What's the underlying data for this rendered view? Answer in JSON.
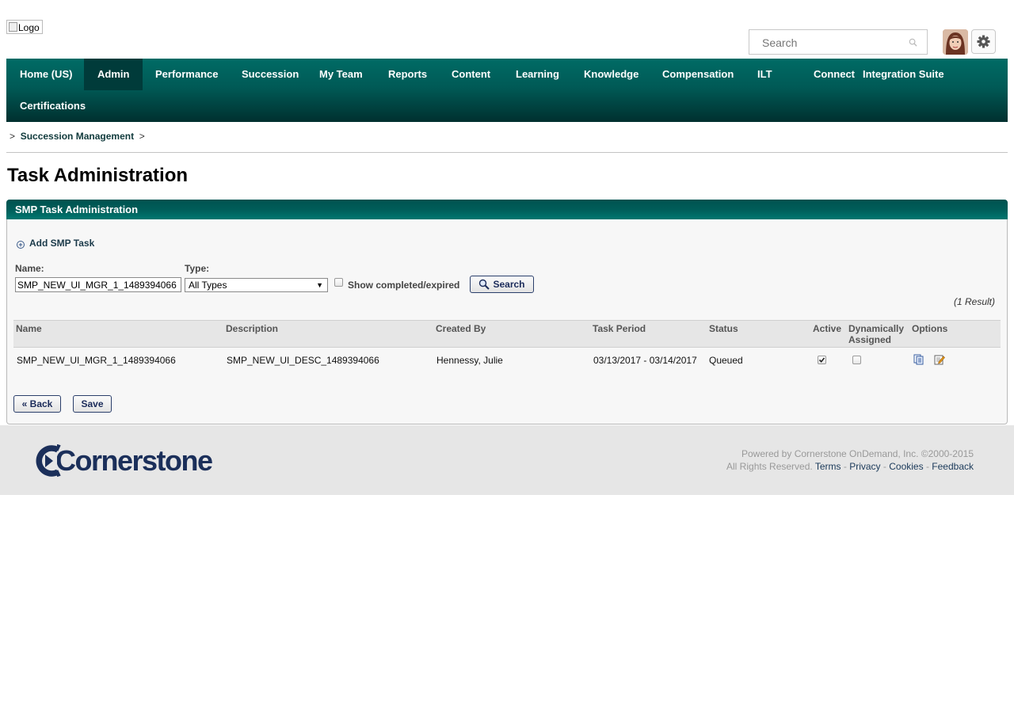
{
  "header": {
    "logo_alt": "Logo",
    "search": {
      "placeholder": "Search"
    }
  },
  "nav": {
    "items": [
      {
        "label": "Home (US)"
      },
      {
        "label": "Admin",
        "active": true
      },
      {
        "label": "Performance"
      },
      {
        "label": "Succession"
      },
      {
        "label": "My Team"
      },
      {
        "label": "Reports"
      },
      {
        "label": "Content"
      },
      {
        "label": "Learning"
      },
      {
        "label": "Knowledge"
      },
      {
        "label": "Compensation"
      },
      {
        "label": "ILT"
      },
      {
        "label": "Connect"
      },
      {
        "label": "Integration Suite"
      },
      {
        "label": "Certifications"
      }
    ]
  },
  "breadcrumb": {
    "sep": ">",
    "item": "Succession Management"
  },
  "page_title": "Task Administration",
  "panel": {
    "title": "SMP Task Administration",
    "add_task_label": "Add SMP Task",
    "filters": {
      "name_label": "Name:",
      "name_value": "SMP_NEW_UI_MGR_1_1489394066",
      "type_label": "Type:",
      "type_selected": "All Types",
      "show_completed_label": "Show completed/expired",
      "search_button": "Search"
    },
    "result_count": "(1 Result)",
    "table": {
      "headers": {
        "name": "Name",
        "description": "Description",
        "created_by": "Created By",
        "task_period": "Task Period",
        "status": "Status",
        "active": "Active",
        "dynamically_assigned_1": "Dynamically",
        "dynamically_assigned_2": "Assigned",
        "options": "Options"
      },
      "rows": [
        {
          "name": "SMP_NEW_UI_MGR_1_1489394066",
          "description": "SMP_NEW_UI_DESC_1489394066",
          "created_by": "Hennessy, Julie",
          "task_period": "03/13/2017 - 03/14/2017",
          "status": "Queued",
          "active": true,
          "dynamically_assigned": false
        }
      ]
    },
    "back_button": "« Back",
    "save_button": "Save"
  },
  "footer": {
    "brand": "Cornerstone",
    "powered_by": "Powered by Cornerstone OnDemand, Inc. ©2000-2015",
    "rights": "All Rights Reserved.",
    "links": {
      "terms": "Terms",
      "privacy": "Privacy",
      "cookies": "Cookies",
      "feedback": "Feedback"
    },
    "link_sep": "-"
  },
  "colors": {
    "nav_top": "#006b65",
    "nav_bottom": "#00302f",
    "active_tab": "#003b3a",
    "brand_navy": "#1b2f5a"
  }
}
